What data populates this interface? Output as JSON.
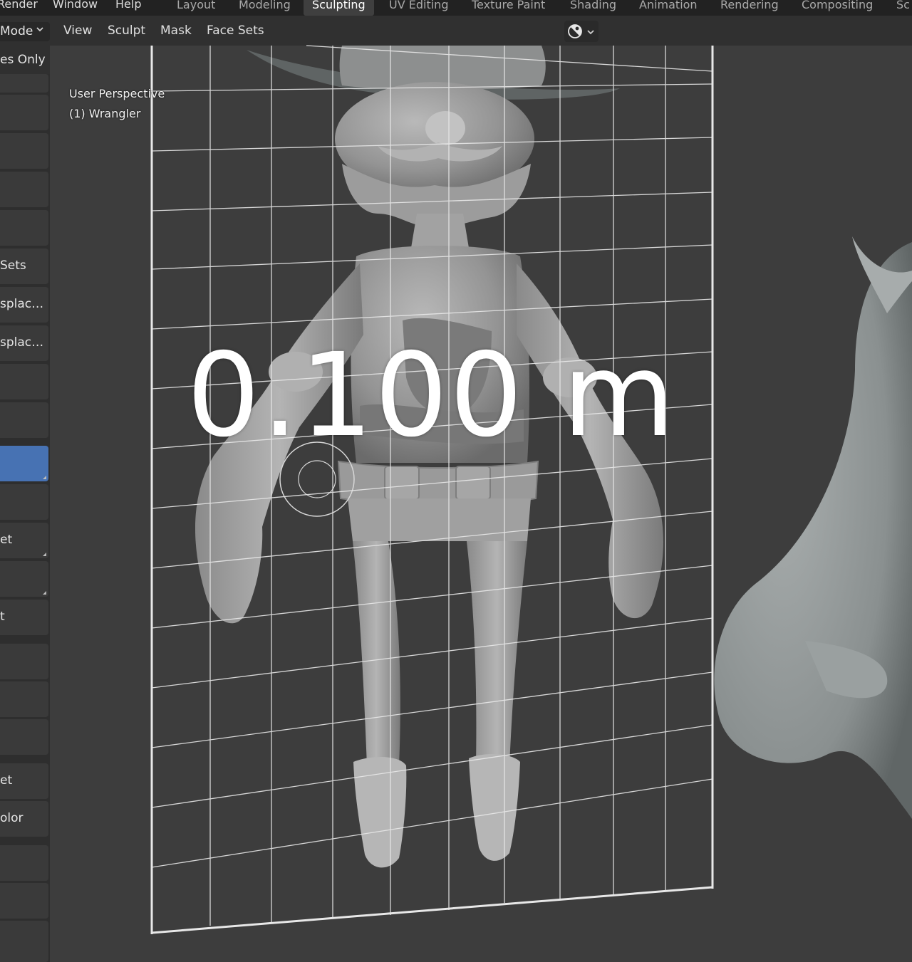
{
  "top_menu": {
    "items": [
      "Render",
      "Window",
      "Help"
    ]
  },
  "workspace_tabs": [
    {
      "label": "Layout"
    },
    {
      "label": "Modeling"
    },
    {
      "label": "Sculpting",
      "active": true
    },
    {
      "label": "UV Editing"
    },
    {
      "label": "Texture Paint"
    },
    {
      "label": "Shading"
    },
    {
      "label": "Animation"
    },
    {
      "label": "Rendering"
    },
    {
      "label": "Compositing"
    },
    {
      "label": "Sc"
    }
  ],
  "header": {
    "mode": "Mode",
    "menus": [
      "View",
      "Sculpt",
      "Mask",
      "Face Sets"
    ],
    "overlay_icon": "overlay-toggle-icon"
  },
  "tool_settings": {
    "option_label": "es Only"
  },
  "toolbar": {
    "labels": {
      "sets": "Sets",
      "displace_1": "splac…",
      "displace_2": "splac…",
      "set_1": "et",
      "t": "t",
      "set_2": "et",
      "color": "olor"
    },
    "active_color": "#4772b3"
  },
  "viewport": {
    "perspective": "User Perspective",
    "object": "(1) Wrangler",
    "measurement": "0.100 m"
  },
  "colors": {
    "accent": "#4772b3",
    "background": "#3d3d3d",
    "header": "#303030",
    "topbar": "#222222"
  }
}
